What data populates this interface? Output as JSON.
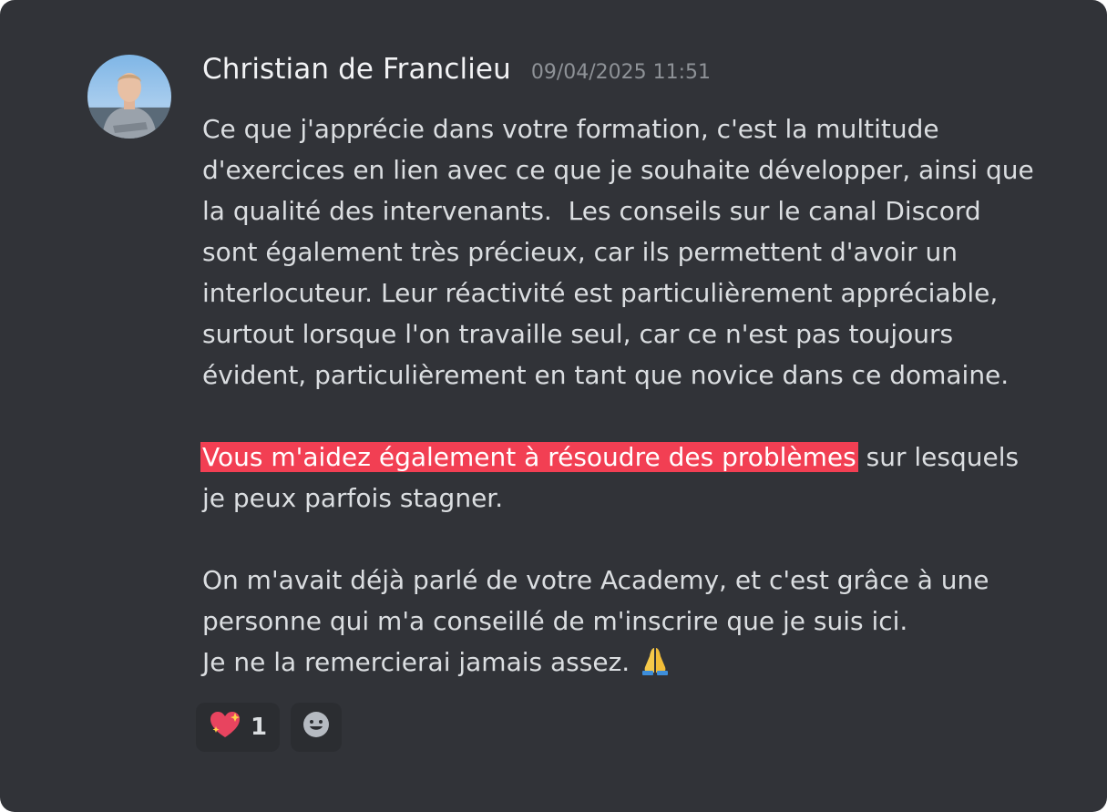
{
  "message": {
    "author": "Christian de Franclieu",
    "timestamp": "09/04/2025 11:51",
    "paragraph1": [
      "Ce que j'apprécie dans votre formation, c'est la multitude",
      "d'exercices en lien avec ce que je souhaite développer, ainsi que",
      "la qualité des intervenants.  Les conseils sur le canal Discord",
      "sont également très précieux, car ils permettent d'avoir un",
      "interlocuteur. Leur réactivité est particulièrement appréciable,",
      "surtout lorsque l'on travaille seul, car ce n'est pas toujours",
      "évident, particulièrement en tant que novice dans ce domaine."
    ],
    "paragraph2": {
      "highlighted": "Vous m'aidez également à résoudre des problèmes",
      "rest": " sur lesquels",
      "line2": "je peux parfois stagner."
    },
    "paragraph3": [
      "On m'avait déjà parlé de votre Academy, et c'est grâce à une",
      "personne qui m'a conseillé de m'inscrire que je suis ici.",
      "Je ne la remercierai jamais assez."
    ],
    "end_emoji": "folded-hands-icon"
  },
  "reactions": [
    {
      "icon": "sparkling-heart-icon",
      "count": "1"
    }
  ],
  "add_reaction_icon": "smiley-add-reaction-icon",
  "colors": {
    "background": "#313338",
    "highlight": "#f23f53",
    "text": "#dbdee1",
    "username": "#f2f3f5",
    "timestamp": "#8e9297"
  }
}
